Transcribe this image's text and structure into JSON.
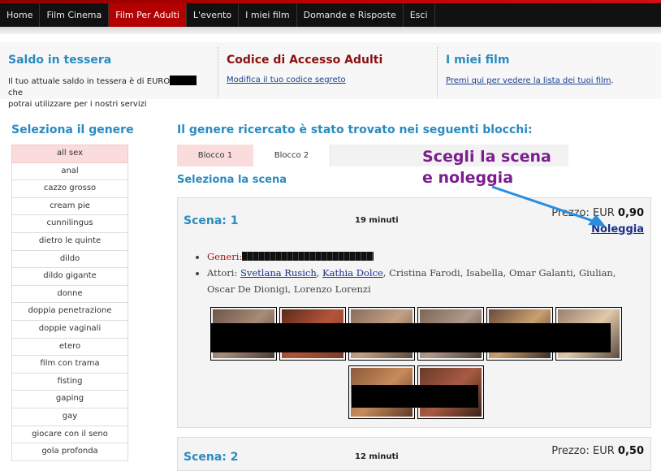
{
  "nav": {
    "items": [
      {
        "label": "Home"
      },
      {
        "label": "Film Cinema"
      },
      {
        "label": "Film Per Adulti",
        "active": true
      },
      {
        "label": "L'evento"
      },
      {
        "label": "I miei film"
      },
      {
        "label": "Domande e Risposte"
      },
      {
        "label": "Esci"
      }
    ]
  },
  "info": {
    "saldo": {
      "title": "Saldo in tessera",
      "text_before": "Il tuo attuale saldo in tessera è di EURO",
      "text_after": "che",
      "text_line2": "potrai utilizzare per i nostri servizi"
    },
    "codice": {
      "title": "Codice di Accesso Adulti",
      "link": "Modifica il tuo codice segreto"
    },
    "miei": {
      "title": "I miei film",
      "link": "Premi qui per vedere la lista dei tuoi film",
      "link_suffix": "."
    }
  },
  "sidebar": {
    "title": "Seleziona il genere",
    "genres": [
      "all sex",
      "anal",
      "cazzo grosso",
      "cream pie",
      "cunnilingus",
      "dietro le quinte",
      "dildo",
      "dildo gigante",
      "donne",
      "doppia penetrazione",
      "doppie vaginali",
      "etero",
      "film con trama",
      "fisting",
      "gaping",
      "gay",
      "giocare con il seno",
      "gola profonda"
    ]
  },
  "main": {
    "title": "Il genere ricercato è stato trovato nei seguenti blocchi:",
    "tabs": [
      {
        "label": "Blocco 1",
        "active": true
      },
      {
        "label": "Blocco 2"
      }
    ],
    "scene_heading": "Seleziona la scena",
    "annotation_line1": "Scegli la scena",
    "annotation_line2": "e noleggia"
  },
  "scenes": [
    {
      "title": "Scena: 1",
      "duration": "19 minuti",
      "price_label": "Prezzo: EUR",
      "price_value": "0,90",
      "rent_label": "Noleggia",
      "genres_label": "Generi:",
      "actors_label": "Attori:",
      "actors_linked": [
        "Svetlana Rusich",
        "Kathia Dolce"
      ],
      "actors_rest": ", Cristina Farodi, Isabella, Omar Galanti, Giulian, Oscar De Dionigi, Lorenzo Lorenzi"
    },
    {
      "title": "Scena: 2",
      "duration": "12 minuti",
      "price_label": "Prezzo: EUR",
      "price_value": "0,50"
    }
  ],
  "colors": {
    "accent_red": "#b30000",
    "heading_blue": "#2a8bc0",
    "annotation_purple": "#7a1e8e",
    "arrow_blue": "#2a8de0"
  }
}
